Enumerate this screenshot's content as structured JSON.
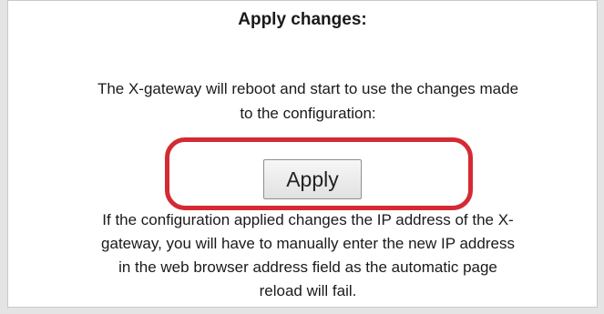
{
  "panel": {
    "title": "Apply changes:",
    "description_line1": "The X-gateway will reboot and start to use the changes made",
    "description_line2": "to the configuration:",
    "apply_button_label": "Apply",
    "note_line1": "If the configuration applied changes the IP address of the X-",
    "note_line2": "gateway, you will have to manually enter the new IP address",
    "note_line3": "in the web browser address field as the automatic page",
    "note_line4": "reload will fail."
  },
  "colors": {
    "highlight": "#d42a33",
    "page_background": "#ffffff"
  }
}
